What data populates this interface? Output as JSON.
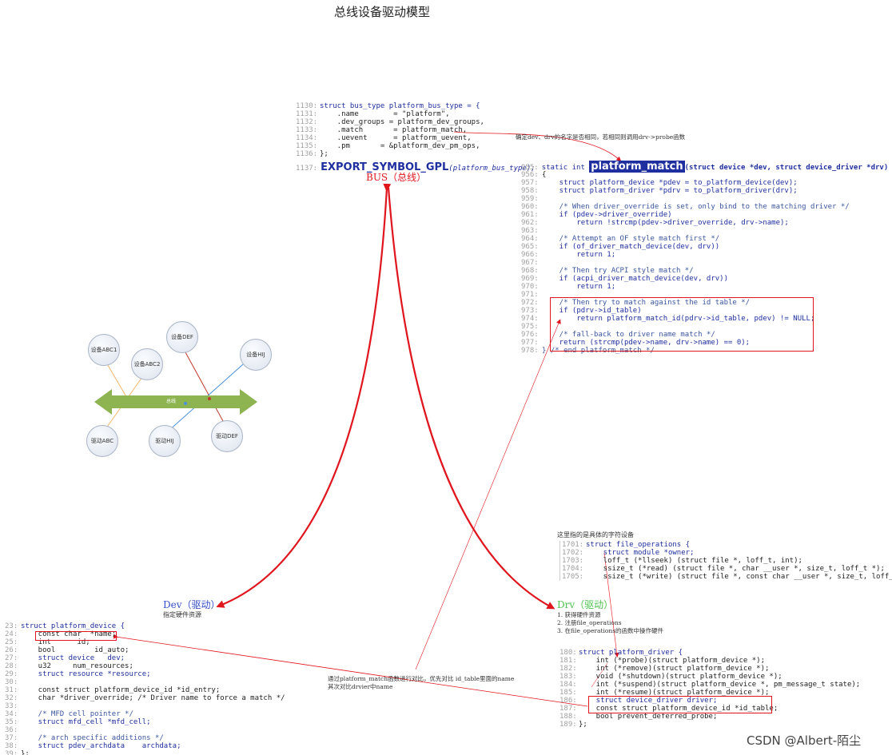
{
  "title": "总线设备驱动模型",
  "watermark": "CSDN @Albert-陌尘",
  "labels": {
    "bus": "BUS（总线）",
    "dev": "Dev（驱动）",
    "dev_sub": "指定硬件资源",
    "drv": "Drv（驱动）",
    "drv_steps": [
      "1. 获得硬件资源",
      "2. 注册file_operations",
      "3. 在file_operations的函数中操作硬件"
    ],
    "fops_note": "这里指的是具体的字符设备",
    "match_note": "确定dev、drv的名字是否相同，若相同则调用drv->probe函数",
    "compare_note_1": "通过platform_match函数进行对比，优先对比 id_table里面的name",
    "compare_note_2": "其次对比drvier中name"
  },
  "diagram": {
    "bus_label": "总线",
    "devices": [
      "设备ABC1",
      "设备ABC2",
      "设备DEF",
      "设备HIJ"
    ],
    "drivers": [
      "驱动ABC",
      "驱动HIJ",
      "驱动DEF"
    ],
    "colors": {
      "bus": "#8db450",
      "line_abc": "#f2b56a",
      "line_def": "#c0392b",
      "line_hij": "#4a90d9",
      "arrow": "#e0161e"
    }
  },
  "code": {
    "bus_type": [
      {
        "ln": "1130:",
        "text": "struct bus_type platform_bus_type = {"
      },
      {
        "ln": "1131:",
        "text": "    .name        = \"platform\","
      },
      {
        "ln": "1132:",
        "text": "    .dev_groups = platform_dev_groups,"
      },
      {
        "ln": "1133:",
        "text": "    .match       = platform_match,"
      },
      {
        "ln": "1134:",
        "text": "    .uevent      = platform_uevent,"
      },
      {
        "ln": "1135:",
        "text": "    .pm       = &platform_dev_pm_ops,"
      },
      {
        "ln": "1136:",
        "text": "};"
      }
    ],
    "export_ln": "1137:",
    "export_fn": "EXPORT_SYMBOL_GPL",
    "export_arg": "(platform_bus_type);",
    "match_header_ln": "955:",
    "match_header_pre": "static int ",
    "match_header_fn": "platform_match",
    "match_header_post": "(struct device *dev, struct device_driver *drv)",
    "match_body": [
      {
        "ln": "956:",
        "text": "{"
      },
      {
        "ln": "957:",
        "text": "    struct platform_device *pdev = to_platform_device(dev);"
      },
      {
        "ln": "958:",
        "text": "    struct platform_driver *pdrv = to_platform_driver(drv);"
      },
      {
        "ln": "959:",
        "text": ""
      },
      {
        "ln": "960:",
        "text": "    /* When driver_override is set, only bind to the matching driver */"
      },
      {
        "ln": "961:",
        "text": "    if (pdev->driver_override)"
      },
      {
        "ln": "962:",
        "text": "        return !strcmp(pdev->driver_override, drv->name);"
      },
      {
        "ln": "963:",
        "text": ""
      },
      {
        "ln": "964:",
        "text": "    /* Attempt an OF style match first */"
      },
      {
        "ln": "965:",
        "text": "    if (of_driver_match_device(dev, drv))"
      },
      {
        "ln": "966:",
        "text": "        return 1;"
      },
      {
        "ln": "967:",
        "text": ""
      },
      {
        "ln": "968:",
        "text": "    /* Then try ACPI style match */"
      },
      {
        "ln": "969:",
        "text": "    if (acpi_driver_match_device(dev, drv))"
      },
      {
        "ln": "970:",
        "text": "        return 1;"
      },
      {
        "ln": "971:",
        "text": ""
      },
      {
        "ln": "972:",
        "text": "    /* Then try to match against the id table */"
      },
      {
        "ln": "973:",
        "text": "    if (pdrv->id_table)"
      },
      {
        "ln": "974:",
        "text": "        return platform_match_id(pdrv->id_table, pdev) != NULL;"
      },
      {
        "ln": "975:",
        "text": ""
      },
      {
        "ln": "976:",
        "text": "    /* fall-back to driver name match */"
      },
      {
        "ln": "977:",
        "text": "    return (strcmp(pdev->name, drv->name) == 0);"
      },
      {
        "ln": "978:",
        "text": "} /* end platform_match */"
      }
    ],
    "file_operations": [
      {
        "ln": "1701:",
        "text": "struct file_operations {"
      },
      {
        "ln": "1702:",
        "text": "    struct module *owner;"
      },
      {
        "ln": "1703:",
        "text": "    loff_t (*llseek) (struct file *, loff_t, int);"
      },
      {
        "ln": "1704:",
        "text": "    ssize_t (*read) (struct file *, char __user *, size_t, loff_t *);"
      },
      {
        "ln": "1705:",
        "text": "    ssize_t (*write) (struct file *, const char __user *, size_t, loff_t *);"
      }
    ],
    "platform_device": [
      {
        "ln": "23:",
        "text": "struct platform_device {"
      },
      {
        "ln": "24:",
        "text": "    const char  *name;"
      },
      {
        "ln": "25:",
        "text": "    int      id;"
      },
      {
        "ln": "26:",
        "text": "    bool         id_auto;"
      },
      {
        "ln": "27:",
        "text": "    struct device   dev;"
      },
      {
        "ln": "28:",
        "text": "    u32     num_resources;"
      },
      {
        "ln": "29:",
        "text": "    struct resource *resource;"
      },
      {
        "ln": "30:",
        "text": ""
      },
      {
        "ln": "31:",
        "text": "    const struct platform_device_id *id_entry;"
      },
      {
        "ln": "32:",
        "text": "    char *driver_override; /* Driver name to force a match */"
      },
      {
        "ln": "33:",
        "text": ""
      },
      {
        "ln": "34:",
        "text": "    /* MFD cell pointer */"
      },
      {
        "ln": "35:",
        "text": "    struct mfd_cell *mfd_cell;"
      },
      {
        "ln": "36:",
        "text": ""
      },
      {
        "ln": "37:",
        "text": "    /* arch specific additions */"
      },
      {
        "ln": "38:",
        "text": "    struct pdev_archdata    archdata;"
      },
      {
        "ln": "39:",
        "text": "};"
      }
    ],
    "platform_driver": [
      {
        "ln": "180:",
        "text": "struct platform_driver {"
      },
      {
        "ln": "181:",
        "text": "    int (*probe)(struct platform_device *);"
      },
      {
        "ln": "182:",
        "text": "    int (*remove)(struct platform_device *);"
      },
      {
        "ln": "183:",
        "text": "    void (*shutdown)(struct platform_device *);"
      },
      {
        "ln": "184:",
        "text": "    int (*suspend)(struct platform_device *, pm_message_t state);"
      },
      {
        "ln": "185:",
        "text": "    int (*resume)(struct platform_device *);"
      },
      {
        "ln": "186:",
        "text": "    struct device_driver driver;"
      },
      {
        "ln": "187:",
        "text": "    const struct platform_device_id *id_table;"
      },
      {
        "ln": "188:",
        "text": "    bool prevent_deferred_probe;"
      },
      {
        "ln": "189:",
        "text": "};"
      }
    ]
  }
}
